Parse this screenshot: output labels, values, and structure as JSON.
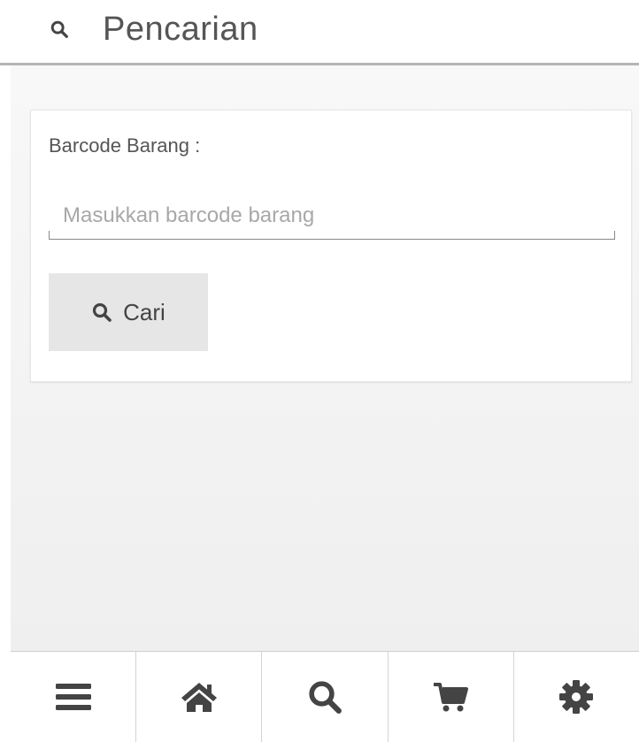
{
  "header": {
    "icon": "search-icon",
    "title": "Pencarian"
  },
  "form": {
    "barcode_label": "Barcode Barang :",
    "barcode_value": "",
    "barcode_placeholder": "Masukkan barcode barang",
    "search_button": {
      "icon": "search-icon",
      "label": "Cari"
    }
  },
  "bottom_nav": {
    "items": [
      {
        "icon": "menu-icon"
      },
      {
        "icon": "home-icon"
      },
      {
        "icon": "search-icon"
      },
      {
        "icon": "cart-icon"
      },
      {
        "icon": "gear-icon"
      }
    ]
  },
  "colors": {
    "icon_color": "#444444",
    "button_bg": "#e6e6e6",
    "placeholder": "#a8a8a8",
    "header_border": "#b5b5b5"
  }
}
